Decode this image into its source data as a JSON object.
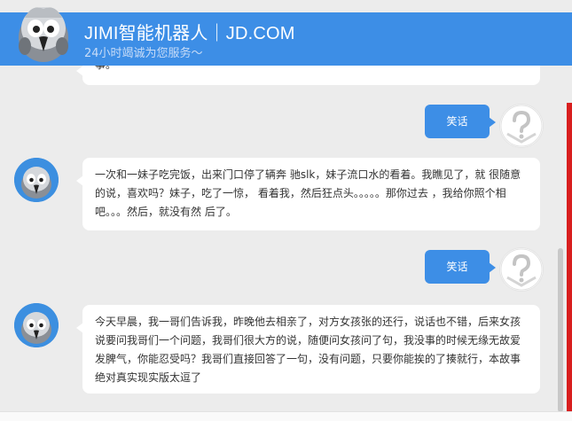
{
  "header": {
    "title": "JIMI智能机器人｜JD.COM",
    "subtitle": "24小时竭诚为您服务～"
  },
  "messages": [
    {
      "from": "bot",
      "text": "事。"
    },
    {
      "from": "user",
      "text": "笑话"
    },
    {
      "from": "bot",
      "text": "一次和一妹子吃完饭，出来门口停了辆奔 驰slk，妹子流口水的看着。我瞧见了，就 很随意的说，喜欢吗？妹子，吃了一惊， 看着我，然后狂点头。。。。。那你过去 ，我给你照个相吧。。。然后，就没有然 后了。"
    },
    {
      "from": "user",
      "text": "笑话"
    },
    {
      "from": "bot",
      "text": "今天早晨，我一哥们告诉我，昨晚他去相亲了，对方女孩张的还行，说话也不错，后来女孩说要问我哥们一个问题，我哥们很大方的说，随便问女孩问了句，我没事的时候无缘无故爱发脾气，你能忍受吗？我哥们直接回答了一句，没有问题，只要你能挨的了揍就行，本故事绝对真实现实版太逗了"
    }
  ],
  "colors": {
    "accent": "#3d8ee6",
    "scroll_red": "#d81e1e"
  },
  "icons": {
    "bot_avatar": "parrot-robot-icon",
    "user_avatar": "question-mark-icon"
  }
}
